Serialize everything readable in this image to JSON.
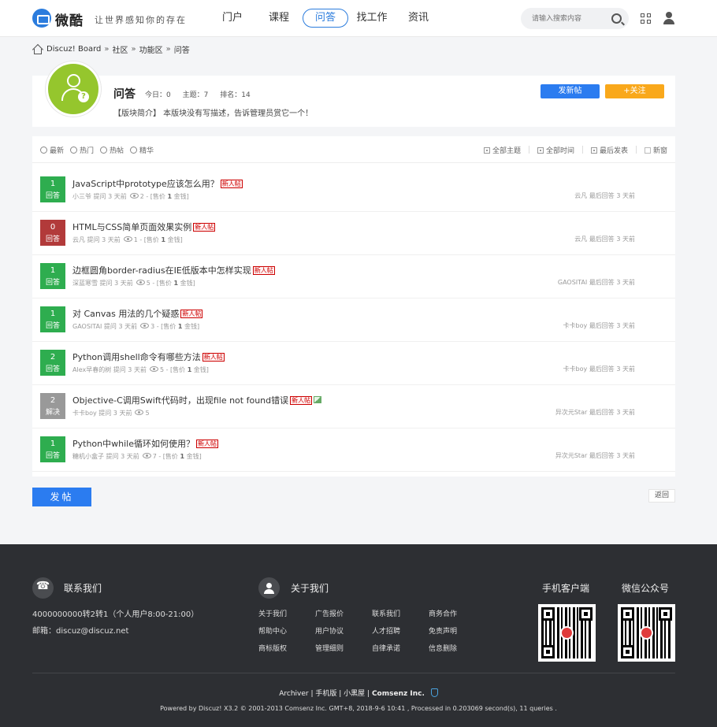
{
  "header": {
    "logo_name": "微酷",
    "slogan": "让世界感知你的存在",
    "nav": [
      "门户",
      "课程",
      "问答",
      "找工作",
      "资讯"
    ],
    "active_nav": 2,
    "search_placeholder": "请输入搜索内容"
  },
  "breadcrumb": [
    "Discuz! Board",
    "社区",
    "功能区",
    "问答"
  ],
  "breadcrumb_sep": "»",
  "forum": {
    "name": "问答",
    "today": "今日：0",
    "topics": "主题：7",
    "rank": "排名：14",
    "intro": "【版块简介】  本版块没有写描述，告诉管理员赏它一个！",
    "new_post_label": "发新帖",
    "follow_label": "+关注"
  },
  "filters": {
    "left": [
      "最新",
      "热门",
      "热帖",
      "精华"
    ],
    "right": [
      "全部主题",
      "全部时间",
      "最后发表"
    ],
    "new_window": "新窗"
  },
  "threads": [
    {
      "count": "1",
      "status": "回答",
      "color": "#2ead4f",
      "title": "JavaScript中prototype应该怎么用？",
      "new": true,
      "img": false,
      "author": "小三爷",
      "asked": "提问 3 天前",
      "views": "2",
      "reward": "- [售价 ",
      "reward_num": "1",
      "reward_unit": " 金钱]",
      "last_user": "云凡",
      "last_time": "最后回答 3 天前"
    },
    {
      "count": "0",
      "status": "回答",
      "color": "#b23a3a",
      "title": "HTML与CSS简单页面效果实例",
      "new": true,
      "img": false,
      "author": "云凡",
      "asked": "提问 3 天前",
      "views": "1",
      "reward": "- [售价 ",
      "reward_num": "1",
      "reward_unit": " 金钱]",
      "last_user": "云凡",
      "last_time": "最后回答 3 天前"
    },
    {
      "count": "1",
      "status": "回答",
      "color": "#2ead4f",
      "title": "边框圆角border-radius在IE低版本中怎样实现",
      "new": true,
      "img": false,
      "author": "深蓝寒雪",
      "asked": "提问 3 天前",
      "views": "5",
      "reward": "- [售价 ",
      "reward_num": "1",
      "reward_unit": " 金钱]",
      "last_user": "GAOSITAI",
      "last_time": "最后回答 3 天前"
    },
    {
      "count": "1",
      "status": "回答",
      "color": "#2ead4f",
      "title": "对 Canvas 用法的几个疑惑",
      "new": true,
      "img": false,
      "author": "GAOSITAI",
      "asked": "提问 3 天前",
      "views": "3",
      "reward": "- [售价 ",
      "reward_num": "1",
      "reward_unit": " 金钱]",
      "last_user": "卡卡boy",
      "last_time": "最后回答 3 天前"
    },
    {
      "count": "2",
      "status": "回答",
      "color": "#2ead4f",
      "title": "Python调用shell命令有哪些方法",
      "new": true,
      "img": false,
      "author": "Alex早春的树",
      "asked": "提问 3 天前",
      "views": "5",
      "reward": "- [售价 ",
      "reward_num": "1",
      "reward_unit": " 金钱]",
      "last_user": "卡卡boy",
      "last_time": "最后回答 3 天前"
    },
    {
      "count": "2",
      "status": "解决",
      "color": "#999999",
      "title": "Objective-C调用Swift代码时，出现file not found错误",
      "new": true,
      "img": true,
      "author": "卡卡boy",
      "asked": "提问 3 天前",
      "views": "5",
      "reward": "",
      "reward_num": "",
      "reward_unit": "",
      "last_user": "异次元Star",
      "last_time": "最后回答 3 天前"
    },
    {
      "count": "1",
      "status": "回答",
      "color": "#2ead4f",
      "title": "Python中while循环如何使用？",
      "new": true,
      "img": false,
      "author": "糖机小盒子",
      "asked": "提问 3 天前",
      "views": "7",
      "reward": "- [售价 ",
      "reward_num": "1",
      "reward_unit": " 金钱]",
      "last_user": "异次元Star",
      "last_time": "最后回答 3 天前"
    }
  ],
  "new_tag": "新人帖",
  "post_button": "发帖",
  "back_button": "返回",
  "footer": {
    "contact_title": "联系我们",
    "phone": "4000000000转2转1（个人用户8:00-21:00）",
    "email": "邮箱：discuz@discuz.net",
    "about_title": "关于我们",
    "about_links": [
      "关于我们",
      "广告报价",
      "联系我们",
      "商务合作",
      "帮助中心",
      "用户协议",
      "人才招聘",
      "免责声明",
      "商标版权",
      "管理细则",
      "自律承诺",
      "信息删除"
    ],
    "mobile_title": "手机客户端",
    "wechat_title": "微信公众号",
    "links": [
      "Archiver",
      "手机版",
      "小黑屋"
    ],
    "company": "Comsenz Inc.",
    "powered": "Powered by Discuz! X3.2 © 2001-2013 Comsenz Inc. GMT+8, 2018-9-6 10:41 , Processed in 0.203069 second(s), 11 queries ."
  }
}
